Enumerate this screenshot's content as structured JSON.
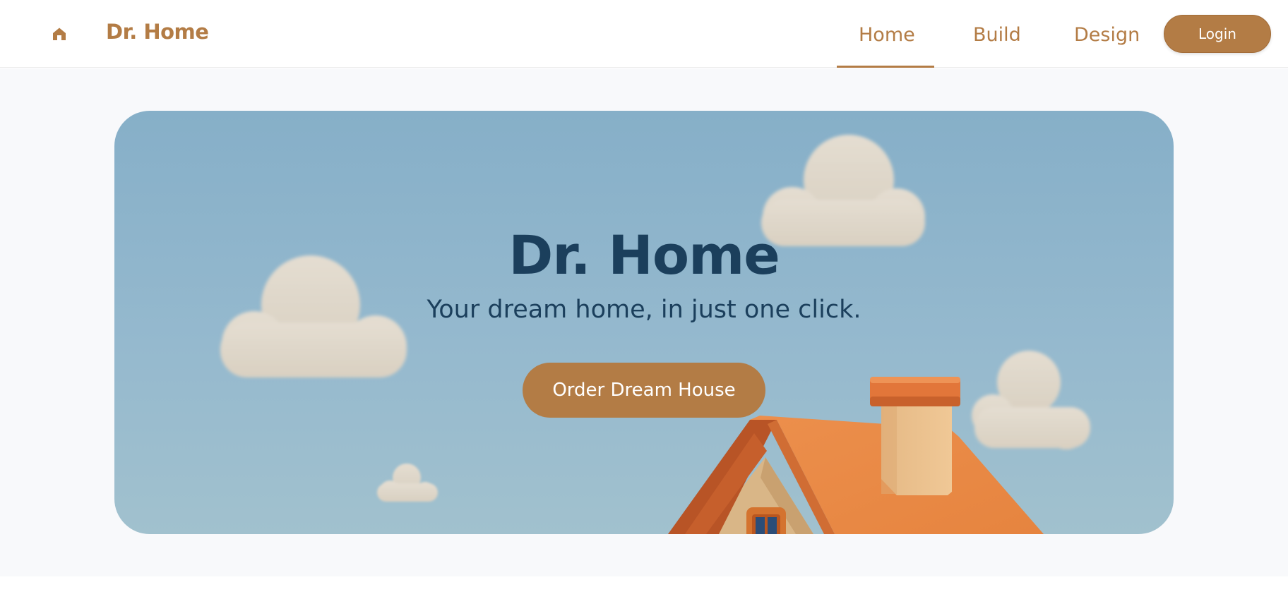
{
  "header": {
    "brand_icon": "home-icon",
    "brand_name": "Dr. Home",
    "nav": {
      "home": "Home",
      "build": "Build",
      "design": "Design"
    },
    "active_nav": "Home",
    "login_label": "Login"
  },
  "hero": {
    "title": "Dr. Home",
    "subtitle": "Your dream home, in just one click.",
    "cta_label": "Order Dream House",
    "illustration": "house-roof-with-clouds"
  },
  "colors": {
    "accent": "#b37c45",
    "title": "#1b3f5c",
    "sky_top": "#86afc8",
    "sky_bottom": "#a1c1ce",
    "roof": "#e8894a",
    "page_background": "#f8f9fb"
  }
}
